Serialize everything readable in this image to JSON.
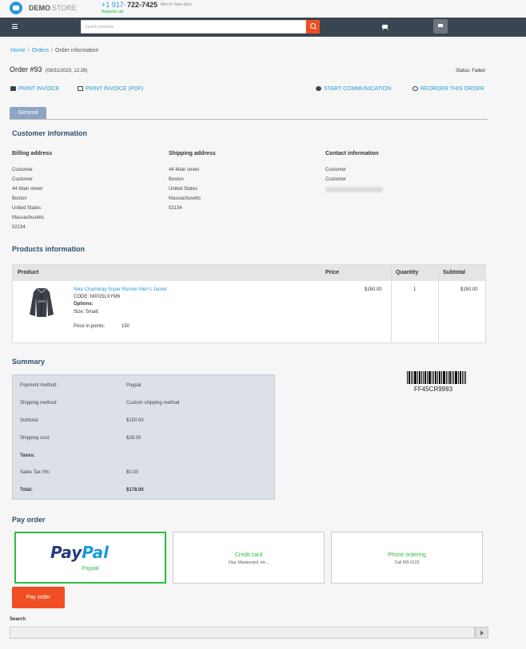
{
  "header": {
    "logo_demo": "DEMO",
    "logo_store": "STORE",
    "phone_prefix": "+1 917-",
    "phone_number": "722-7425",
    "hours": "Mon-Fr 9am-9pm",
    "request_call": "Request call",
    "search_placeholder": "Search products"
  },
  "breadcrumb": {
    "home": "Home",
    "orders": "Orders",
    "current": "Order information"
  },
  "order": {
    "title": "Order #93",
    "date": "(08/31/2020, 12:26)",
    "status": "Status: Failed"
  },
  "actions": {
    "print_invoice": "PRINT INVOICE",
    "print_invoice_pdf": "PRINT INVOICE (PDF)",
    "start_communication": "START COMMUNICATION",
    "reorder": "REORDER THIS ORDER"
  },
  "tabs": {
    "general": "General"
  },
  "customer": {
    "title": "Customer information",
    "billing": {
      "title": "Billing address",
      "lines": [
        "Customer",
        "Customer",
        "44 Main street",
        "Boston",
        "United States",
        "Massachusetts",
        "02134"
      ]
    },
    "shipping": {
      "title": "Shipping address",
      "lines": [
        "44 Main street",
        "Boston",
        "United States",
        "Massachusetts",
        "02134"
      ]
    },
    "contact": {
      "title": "Contact information",
      "lines": [
        "Customer",
        "Customer"
      ]
    }
  },
  "products": {
    "title": "Products information",
    "columns": [
      "Product",
      "Price",
      "Quantity",
      "Subtotal"
    ],
    "item": {
      "name": "Nike Chambray Super Runner Men's Jacket",
      "code": "CODE: N0015LXYM6",
      "options_label": "Options:",
      "size": "Size: Small;",
      "points_label": "Price in points:",
      "points_value": "150",
      "price": "$150.00",
      "quantity": "1",
      "subtotal": "$150.00"
    }
  },
  "summary": {
    "title": "Summary",
    "rows": [
      {
        "label": "Payment method:",
        "value": "Paypal"
      },
      {
        "label": "Shipping method:",
        "value": "Custom shipping method"
      },
      {
        "label": "Subtotal:",
        "value": "$150.00"
      },
      {
        "label": "Shipping cost:",
        "value": "$28.00"
      },
      {
        "label": "Taxes:",
        "value": ""
      },
      {
        "label": "Sales Tax 0%:",
        "value": "$0.00"
      },
      {
        "label": "Total:",
        "value": "$178.00"
      }
    ],
    "barcode": "FF45CR9993"
  },
  "pay": {
    "title": "Pay order",
    "paypal_logo_1": "Pay",
    "paypal_logo_2": "Pal",
    "paypal_label": "Paypal",
    "credit_name": "Credit card",
    "credit_desc": "Visa, Mastercard, etc...",
    "phone_name": "Phone ordering",
    "phone_desc": "Call 555 0123",
    "button": "Pay order"
  },
  "footer_search": {
    "label": "Search"
  },
  "colors": {
    "accent": "#f04e23",
    "link": "#2a9bd6",
    "navbar": "#3a4552",
    "selected_payment": "#2dbe3c"
  }
}
